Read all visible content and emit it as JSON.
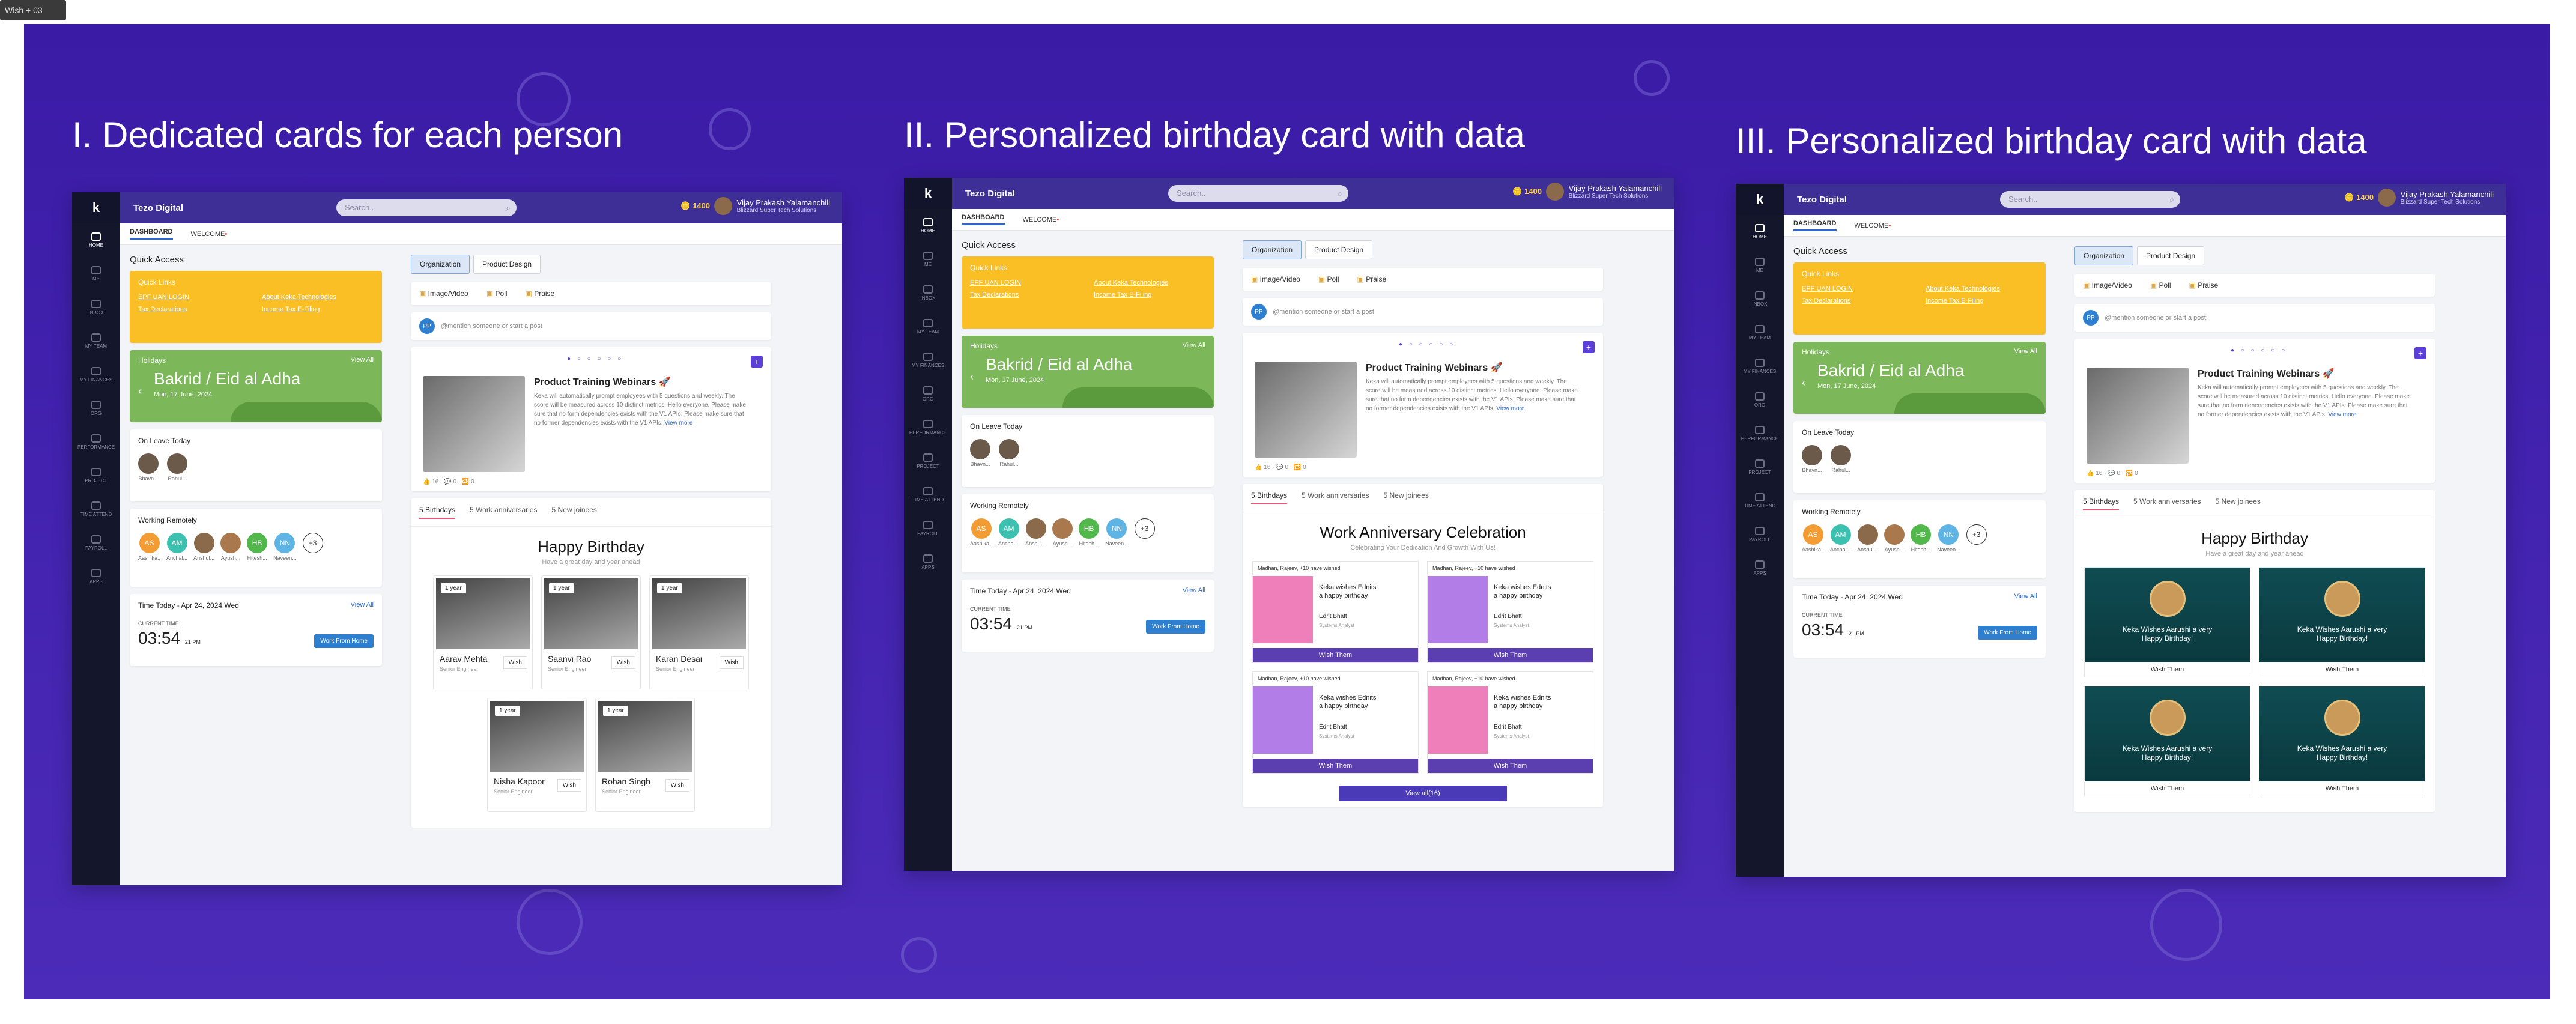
{
  "frame_label": "Wish + 03",
  "titles": {
    "s1": "I. Dedicated cards for each person",
    "s2": "II. Personalized birthday card with data",
    "s3": "III. Personalized birthday card with data"
  },
  "app": {
    "logo": "k",
    "company": "Tezo Digital",
    "search_placeholder": "Search..",
    "coins": "1400",
    "user_name": "Vijay Prakash Yalamanchili",
    "user_org": "Blizzard Super Tech Solutions",
    "tabs": [
      "DASHBOARD",
      "WELCOME"
    ],
    "sidebar": [
      "HOME",
      "ME",
      "INBOX",
      "MY TEAM",
      "MY FINANCES",
      "ORG",
      "PERFORMANCE",
      "PROJECT",
      "TIME ATTEND",
      "PAYROLL",
      "APPS"
    ]
  },
  "left": {
    "quick_access": "Quick Access",
    "quick_links_title": "Quick Links",
    "quick_links": [
      "EPF UAN LOGIN",
      "About Keka Technologies",
      "Tax Declarations",
      "Income Tax E-Filing"
    ],
    "holidays_label": "Holidays",
    "view_all": "View All",
    "holiday_name": "Bakrid / Eid al Adha",
    "holiday_date": "Mon, 17 June, 2024",
    "on_leave": "On Leave Today",
    "leave_people": [
      "Bhavn...",
      "Rahul..."
    ],
    "working_remotely": "Working Remotely",
    "remote_people": [
      {
        "initials": "AS",
        "name": "Aashika..",
        "color": "#f39c34"
      },
      {
        "initials": "AM",
        "name": "Anchal...",
        "color": "#3cc1b0"
      },
      {
        "initials": "",
        "name": "Anshul...",
        "color": "#8a6a4a"
      },
      {
        "initials": "",
        "name": "Ayush...",
        "color": "#a9784c"
      },
      {
        "initials": "HB",
        "name": "Hitesh...",
        "color": "#52b84b"
      },
      {
        "initials": "NN",
        "name": "Naveen...",
        "color": "#5fb4e6"
      },
      {
        "initials": "+3",
        "name": "",
        "color": "#ffffff"
      }
    ],
    "time_today": "Time Today - Apr 24, 2024 Wed",
    "current_time_label": "CURRENT TIME",
    "current_time": "03:54",
    "current_time_suffix": "21 PM",
    "wfh_button": "Work From Home"
  },
  "right": {
    "seg": [
      "Organization",
      "Product Design"
    ],
    "post_actions": [
      "Image/Video",
      "Poll",
      "Praise"
    ],
    "mention_initials": "PP",
    "mention_placeholder": "@mention someone or start a post",
    "feed_title": "Product Training Webinars 🚀",
    "feed_body": "Keka will automatically prompt employees with 5 questions and weekly. The score will be measured across 10 distinct metrics. Hello everyone. Please make sure that no form dependencies exists with the V1 APIs. Please make sure that no former dependencies exists with the V1 APIs.",
    "feed_more": "View more",
    "feed_stats": "👍 16  · 💬 0 · 🔁 0",
    "celebration_tabs": [
      "5 Birthdays",
      "5 Work anniversaries",
      "5 New joinees"
    ]
  },
  "s1": {
    "heading": "Happy Birthday",
    "sub": "Have a great day and year ahead",
    "people": [
      {
        "year": "1 year",
        "name": "Aarav Mehta",
        "role": "Senior Engineer"
      },
      {
        "year": "1 year",
        "name": "Saanvi Rao",
        "role": "Senior Engineer"
      },
      {
        "year": "1 year",
        "name": "Karan Desai",
        "role": "Senior Engineer"
      },
      {
        "year": "1 year",
        "name": "Nisha Kapoor",
        "role": "Senior Engineer"
      },
      {
        "year": "1 year",
        "name": "Rohan Singh",
        "role": "Senior Engineer"
      }
    ],
    "wish": "Wish"
  },
  "s2": {
    "heading": "Work Anniversary Celebration",
    "sub": "Celebrating Your Dedication And Growth With Us!",
    "wished": "Madhan, Rajeev, +10 have wished",
    "msg1": "Keka wishes Ednits",
    "msg2": "a happy birthday",
    "who": "Edrit Bhatt",
    "role": "Systems Analyst",
    "button": "Wish Them",
    "view_all": "View all(16)"
  },
  "s3": {
    "heading": "Happy Birthday",
    "sub": "Have a great day and year ahead",
    "card_text_1": "Keka Wishes Aarushi a very",
    "card_text_2": "Happy Birthday!",
    "button": "Wish Them"
  }
}
